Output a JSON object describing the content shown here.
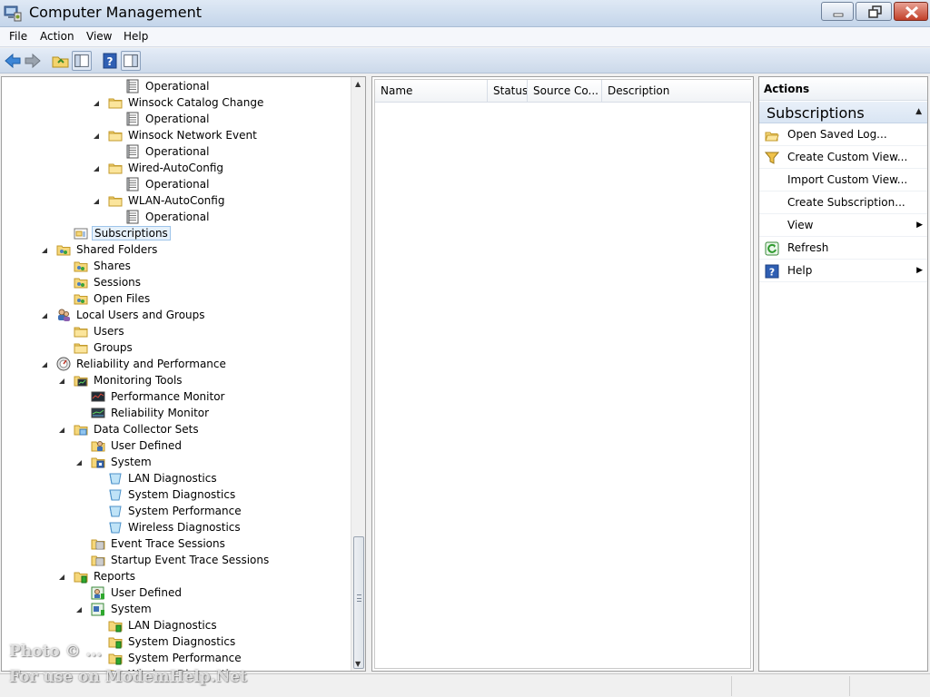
{
  "window": {
    "title": "Computer Management"
  },
  "menu": [
    "File",
    "Action",
    "View",
    "Help"
  ],
  "tree": [
    {
      "label": "Operational",
      "level": 4,
      "icon": "log-icon"
    },
    {
      "label": "Winsock Catalog Change",
      "level": 3,
      "icon": "folder-icon",
      "expanded": true
    },
    {
      "label": "Operational",
      "level": 4,
      "icon": "log-icon"
    },
    {
      "label": "Winsock Network Event",
      "level": 3,
      "icon": "folder-icon",
      "expanded": true
    },
    {
      "label": "Operational",
      "level": 4,
      "icon": "log-icon"
    },
    {
      "label": "Wired-AutoConfig",
      "level": 3,
      "icon": "folder-icon",
      "expanded": true
    },
    {
      "label": "Operational",
      "level": 4,
      "icon": "log-icon"
    },
    {
      "label": "WLAN-AutoConfig",
      "level": 3,
      "icon": "folder-icon",
      "expanded": true
    },
    {
      "label": "Operational",
      "level": 4,
      "icon": "log-icon"
    },
    {
      "label": "Subscriptions",
      "level": 1,
      "icon": "subscriptions-icon",
      "selected": true
    },
    {
      "label": "Shared Folders",
      "level": 0,
      "icon": "shared-folder-icon",
      "expanded": true
    },
    {
      "label": "Shares",
      "level": 1,
      "icon": "shared-folder-icon"
    },
    {
      "label": "Sessions",
      "level": 1,
      "icon": "shared-folder-icon"
    },
    {
      "label": "Open Files",
      "level": 1,
      "icon": "shared-folder-icon"
    },
    {
      "label": "Local Users and Groups",
      "level": 0,
      "icon": "users-groups-icon",
      "expanded": true
    },
    {
      "label": "Users",
      "level": 1,
      "icon": "folder-icon"
    },
    {
      "label": "Groups",
      "level": 1,
      "icon": "folder-icon"
    },
    {
      "label": "Reliability and Performance",
      "level": 0,
      "icon": "gauge-icon",
      "expanded": true
    },
    {
      "label": "Monitoring Tools",
      "level": 1,
      "icon": "monitor-folder-icon",
      "expanded": true
    },
    {
      "label": "Performance Monitor",
      "level": 2,
      "icon": "perf-monitor-icon"
    },
    {
      "label": "Reliability Monitor",
      "level": 2,
      "icon": "reliability-monitor-icon"
    },
    {
      "label": "Data Collector Sets",
      "level": 1,
      "icon": "collector-folder-icon",
      "expanded": true
    },
    {
      "label": "User Defined",
      "level": 2,
      "icon": "user-folder-icon"
    },
    {
      "label": "System",
      "level": 2,
      "icon": "system-folder-icon",
      "expanded": true
    },
    {
      "label": "LAN Diagnostics",
      "level": 3,
      "icon": "collector-set-icon"
    },
    {
      "label": "System Diagnostics",
      "level": 3,
      "icon": "collector-set-icon"
    },
    {
      "label": "System Performance",
      "level": 3,
      "icon": "collector-set-icon"
    },
    {
      "label": "Wireless Diagnostics",
      "level": 3,
      "icon": "collector-set-icon"
    },
    {
      "label": "Event Trace Sessions",
      "level": 2,
      "icon": "trace-folder-icon"
    },
    {
      "label": "Startup Event Trace Sessions",
      "level": 2,
      "icon": "trace-folder-icon"
    },
    {
      "label": "Reports",
      "level": 1,
      "icon": "report-folder-icon",
      "expanded": true
    },
    {
      "label": "User Defined",
      "level": 2,
      "icon": "report-user-icon"
    },
    {
      "label": "System",
      "level": 2,
      "icon": "report-system-icon",
      "expanded": true
    },
    {
      "label": "LAN Diagnostics",
      "level": 3,
      "icon": "report-folder-icon"
    },
    {
      "label": "System Diagnostics",
      "level": 3,
      "icon": "report-folder-icon"
    },
    {
      "label": "System Performance",
      "level": 3,
      "icon": "report-folder-icon"
    },
    {
      "label": "Wireless Diagnostics",
      "level": 3,
      "icon": "report-folder-icon"
    }
  ],
  "list": {
    "columns": [
      "Name",
      "Status",
      "Source Co...",
      "Description"
    ]
  },
  "actions": {
    "title": "Actions",
    "section": "Subscriptions",
    "items": [
      {
        "label": "Open Saved Log...",
        "icon": "open-folder-icon"
      },
      {
        "label": "Create Custom View...",
        "icon": "filter-icon"
      },
      {
        "label": "Import Custom View...",
        "icon": ""
      },
      {
        "label": "Create Subscription...",
        "icon": ""
      },
      {
        "label": "View",
        "icon": "",
        "submenu": true
      },
      {
        "label": "Refresh",
        "icon": "refresh-icon"
      },
      {
        "label": "Help",
        "icon": "help-icon",
        "submenu": true
      }
    ]
  },
  "watermark": {
    "line1": "Photo © ...",
    "line2": "For use on ModemHelp.Net"
  },
  "colors": {
    "titlebar": "#c4d5ea",
    "selection": "#e6f1fb",
    "close": "#c2412a"
  }
}
